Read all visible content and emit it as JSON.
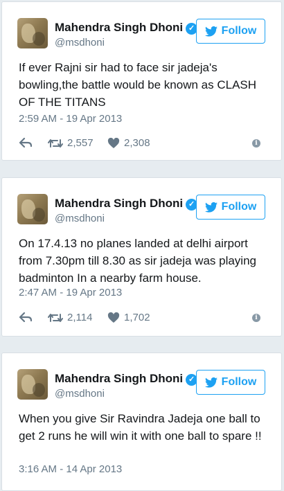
{
  "tweets": [
    {
      "name": "Mahendra Singh Dhoni",
      "handle": "@msdhoni",
      "follow_label": "Follow",
      "text": "If ever Rajni sir had to face sir jadeja's bowling,the battle would be known as CLASH OF THE TITANS",
      "time": "2:59 AM - 19 Apr 2013",
      "retweets": "2,557",
      "likes": "2,308"
    },
    {
      "name": "Mahendra Singh Dhoni",
      "handle": "@msdhoni",
      "follow_label": "Follow",
      "text": "On 17.4.13 no planes landed at delhi airport from 7.30pm till 8.30 as sir jadeja was playing badminton In a nearby farm house.",
      "time": "2:47 AM - 19 Apr 2013",
      "retweets": "2,114",
      "likes": "1,702"
    },
    {
      "name": "Mahendra Singh Dhoni",
      "handle": "@msdhoni",
      "follow_label": "Follow",
      "text": "When you give Sir Ravindra Jadeja one ball to get 2 runs he will win it with one ball to spare !!",
      "time": "3:16 AM - 14 Apr 2013"
    }
  ],
  "colors": {
    "accent": "#1da1f2",
    "secondary_text": "#657786",
    "background": "#e6ecf0"
  },
  "icons": [
    "verified-badge-icon",
    "twitter-bird-icon",
    "reply-icon",
    "retweet-icon",
    "heart-icon",
    "info-icon"
  ]
}
